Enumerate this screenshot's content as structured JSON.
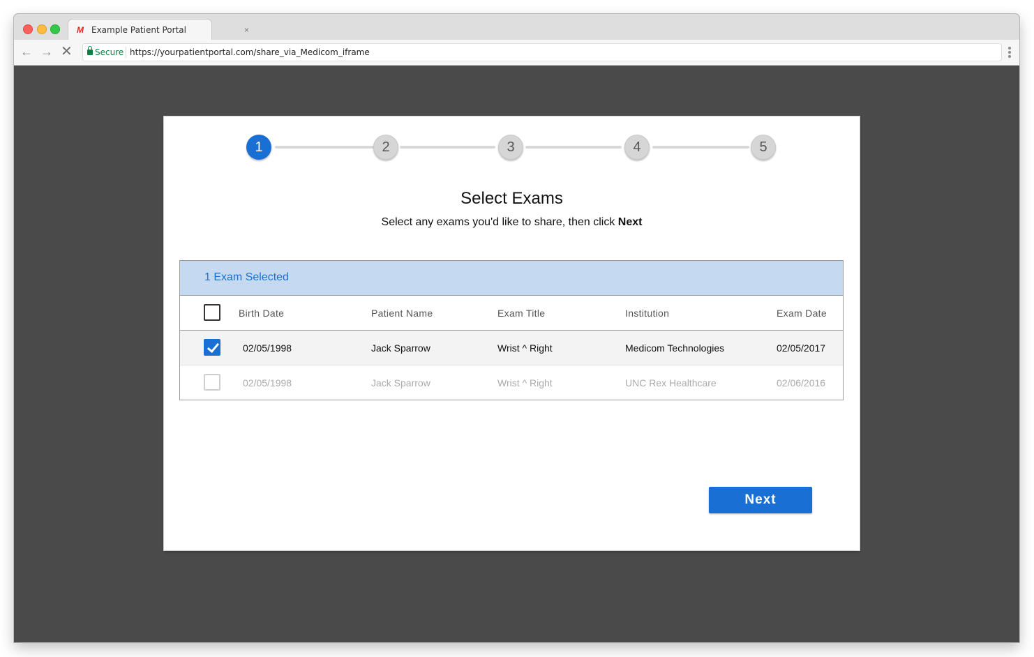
{
  "browser": {
    "tab_title": "Example Patient Portal",
    "tab_close": "×",
    "tab_logo": "M",
    "secure_label": "Secure",
    "url": "https://yourpatientportal.com/share_via_Medicom_iframe"
  },
  "stepper": {
    "steps": [
      "1",
      "2",
      "3",
      "4",
      "5"
    ],
    "active_step": 1
  },
  "page": {
    "title": "Select Exams",
    "subtitle_prefix": "Select any exams you'd like to share, then click ",
    "subtitle_bold": "Next"
  },
  "table": {
    "selection_text": "1 Exam Selected",
    "headers": [
      "Birth Date",
      "Patient Name",
      "Exam Title",
      "Institution",
      "Exam Date"
    ],
    "rows": [
      {
        "checked": true,
        "disabled": false,
        "birth_date": "02/05/1998",
        "patient_name": "Jack Sparrow",
        "exam_title": "Wrist ^ Right",
        "institution": "Medicom Technologies",
        "exam_date": "02/05/2017"
      },
      {
        "checked": false,
        "disabled": true,
        "birth_date": "02/05/1998",
        "patient_name": "Jack Sparrow",
        "exam_title": "Wrist ^ Right",
        "institution": "UNC Rex Healthcare",
        "exam_date": "02/06/2016"
      }
    ]
  },
  "actions": {
    "next_label": "Next"
  },
  "colors": {
    "accent": "#1a6fd4",
    "selection_bar": "#c5daf1",
    "backdrop": "#4a4a4a"
  }
}
